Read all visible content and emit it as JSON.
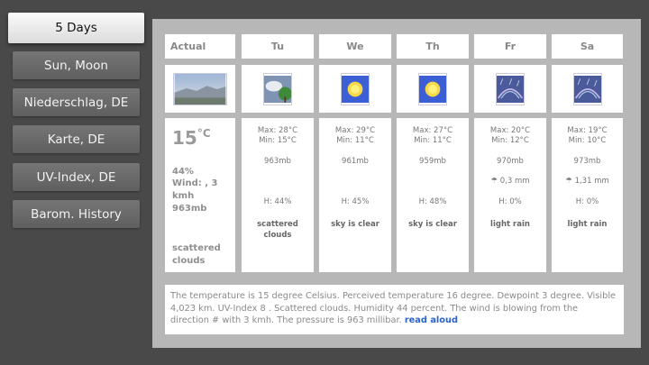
{
  "sidebar": {
    "items": [
      {
        "label": "5 Days",
        "active": true
      },
      {
        "label": "Sun, Moon",
        "active": false
      },
      {
        "label": "Niederschlag, DE",
        "active": false
      },
      {
        "label": "Karte, DE",
        "active": false
      },
      {
        "label": "UV-Index, DE",
        "active": false
      },
      {
        "label": "Barom. History",
        "active": false
      }
    ]
  },
  "actual": {
    "header": "Actual",
    "icon": "landscape-hazy-icon",
    "temp": "15",
    "unit": "°C",
    "humidity": "44%",
    "wind_l1": "Wind: , 3",
    "wind_l2": "kmh",
    "pressure": "963mb",
    "cond_l1": "scattered",
    "cond_l2": "clouds"
  },
  "forecast": [
    {
      "day": "Tu",
      "icon": "cloud-tree-icon",
      "max": "Max: 28°C",
      "min": "Min: 15°C",
      "pressure": "963mb",
      "rain": "",
      "humidity": "H: 44%",
      "cond_l1": "scattered",
      "cond_l2": "clouds"
    },
    {
      "day": "We",
      "icon": "sun-icon",
      "max": "Max: 29°C",
      "min": "Min: 11°C",
      "pressure": "961mb",
      "rain": "",
      "humidity": "H: 45%",
      "cond_l1": "sky is clear",
      "cond_l2": ""
    },
    {
      "day": "Th",
      "icon": "sun-icon",
      "max": "Max: 27°C",
      "min": "Min: 11°C",
      "pressure": "959mb",
      "rain": "",
      "humidity": "H: 48%",
      "cond_l1": "sky is clear",
      "cond_l2": ""
    },
    {
      "day": "Fr",
      "icon": "rain-rainbow-icon",
      "max": "Max: 20°C",
      "min": "Min: 12°C",
      "pressure": "970mb",
      "rain": "0,3 mm",
      "humidity": "H: 0%",
      "cond_l1": "light rain",
      "cond_l2": ""
    },
    {
      "day": "Sa",
      "icon": "rain-rainbow-icon",
      "max": "Max: 19°C",
      "min": "Min: 10°C",
      "pressure": "973mb",
      "rain": "1,31 mm",
      "humidity": "H: 0%",
      "cond_l1": "light rain",
      "cond_l2": ""
    }
  ],
  "description": {
    "text": "The temperature is 15 degree Celsius. Perceived temperature 16 degree. Dewpoint 3 degree. Visible 4,023 km. UV-Index 8 . Scattered clouds. Humidity 44 percent. The wind is blowing from the direction # with 3 kmh. The pressure is 963 millibar.",
    "link": "read aloud"
  },
  "colors": {
    "background": "#494949",
    "panel": "#b7b7b7",
    "link": "#2a64c8"
  }
}
